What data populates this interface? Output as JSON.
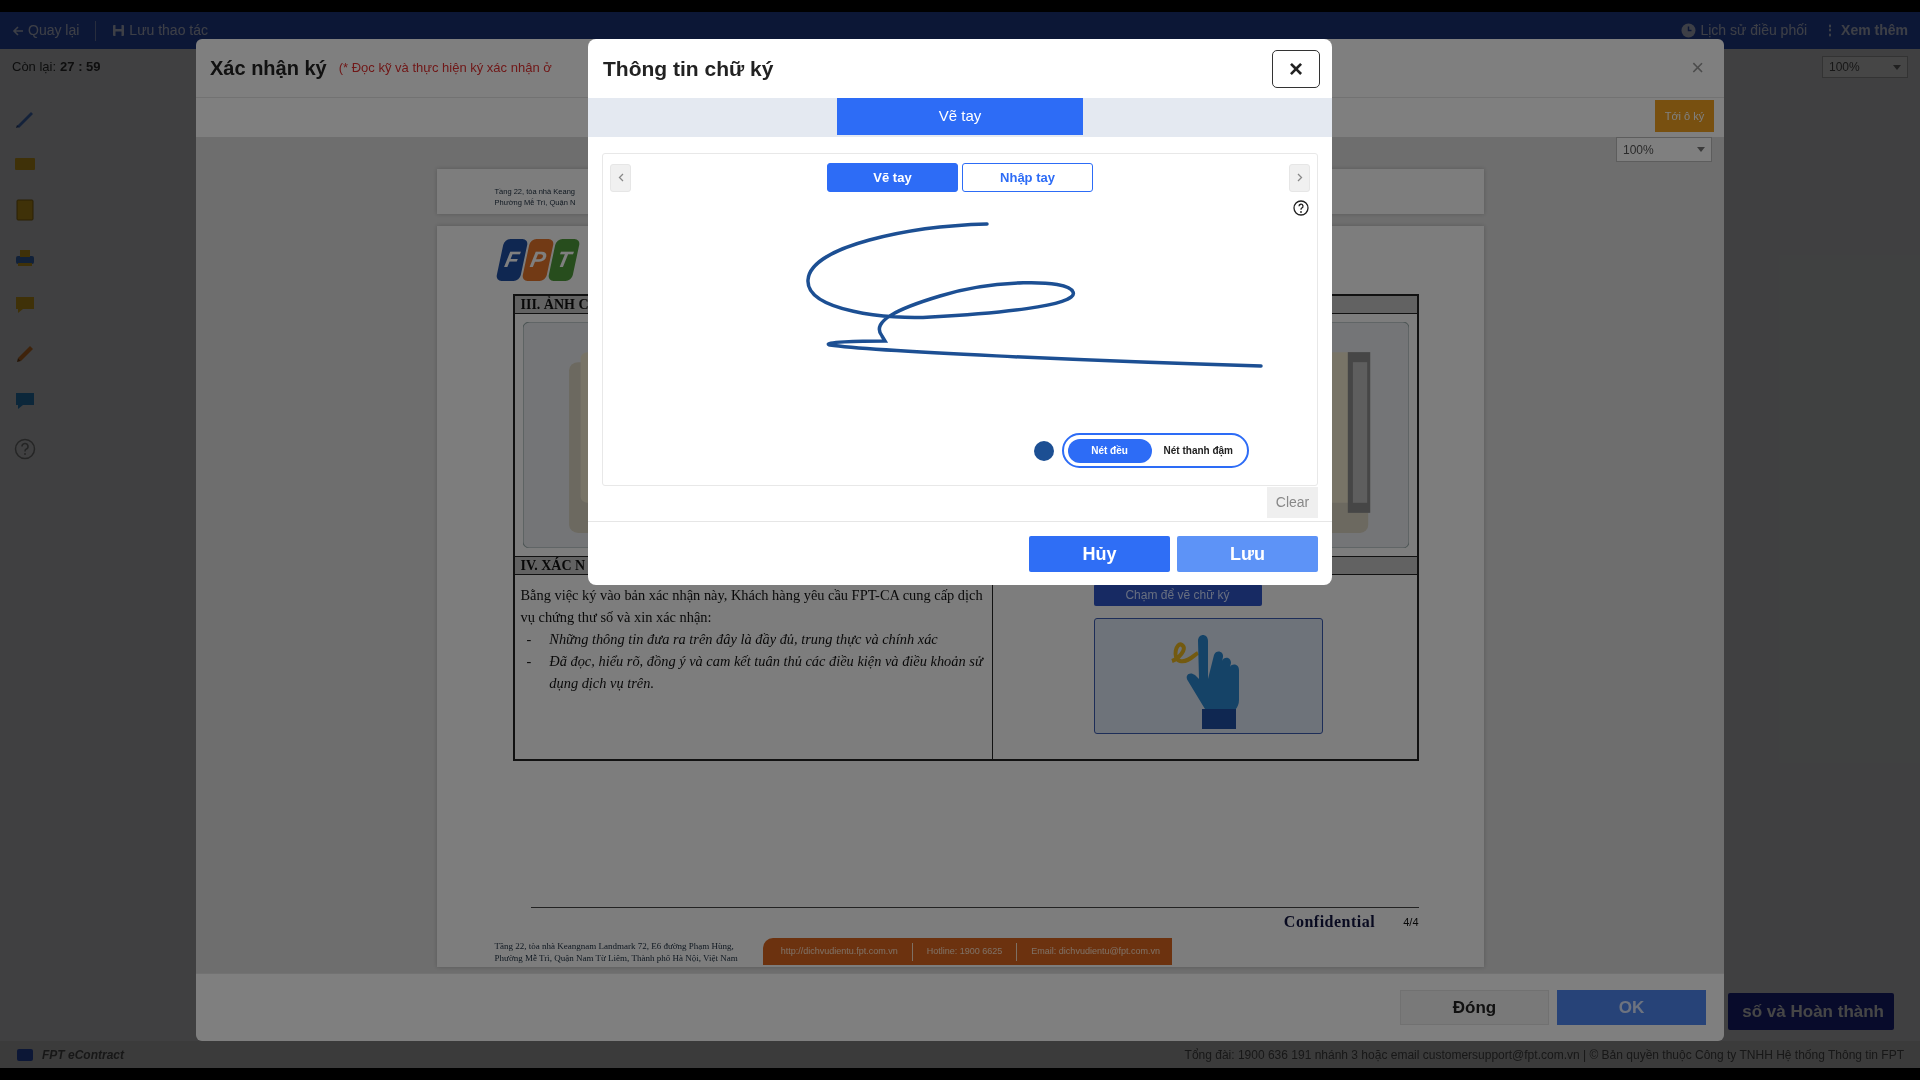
{
  "app": {
    "back": "Quay lại",
    "save": "Lưu thao tác",
    "history": "Lịch sử điều phối",
    "more_icon": "⋮",
    "more": "Xem thêm",
    "timer_label": "Còn lại:",
    "timer": "27 : 59",
    "zoom": "100%",
    "finish_button": "số và Hoàn thành",
    "brand": "FPT eContract",
    "footer_text": "Tổng đài: 1900 636 191 nhánh 3 hoặc email customersupport@fpt.com.vn | © Bản quyền thuộc Công ty TNHH Hệ thống Thông tin FPT"
  },
  "confirm_dialog": {
    "title": "Xác nhận ký",
    "note": "(* Đọc kỹ và thực hiện ký xác nhận ở",
    "close": "×",
    "go_to_sign": "Tới ô ký",
    "zoom": "100%",
    "document": {
      "previous_page_address": [
        "Tầng 22, tòa nhà Keang",
        "Phường Mễ Trì, Quận N"
      ],
      "logo_letters": [
        "F",
        "P",
        "T"
      ],
      "section_3": "III. ẢNH C",
      "section_4": "IV. XÁC N",
      "intro": "Bằng việc ký vào bản xác nhận này, Khách hàng yêu cầu FPT-CA cung cấp dịch vụ chứng thư số và xin xác nhận:",
      "bullets": [
        {
          "mark": "-",
          "text": "Những thông tin đưa ra trên đây là đầy đủ, trung thực và chính xác"
        },
        {
          "mark": "-",
          "text": "Đã đọc, hiểu rõ, đồng ý và cam kết tuân thủ các điều kiện và điều khoản sử dụng dịch vụ trên."
        }
      ],
      "tooltip": "Chạm để vẽ chữ ký",
      "confidential": "Confidential",
      "page": "4/4",
      "address": [
        "Tầng 22, tòa nhà Keangnam Landmark 72, E6 đường Phạm Hùng,",
        "Phường Mễ Trì, Quận Nam Từ Liêm, Thành phố Hà Nội, Việt Nam"
      ],
      "contacts": [
        "http://dichvudientu.fpt.com.vn",
        "Hotline: 1900 6625",
        "Email: dichvudientu@fpt.com.vn"
      ]
    },
    "buttons": [
      {
        "label": "Đóng",
        "kind": "secondary"
      },
      {
        "label": "OK",
        "kind": "primary"
      }
    ]
  },
  "signature_dialog": {
    "title": "Thông tin chữ ký",
    "close": "×",
    "mode_tab": "Vẽ tay",
    "input_modes": [
      {
        "label": "Vẽ tay",
        "selected": true
      },
      {
        "label": "Nhập tay",
        "selected": false
      }
    ],
    "stroke_styles": [
      {
        "label": "Nét đều",
        "selected": true
      },
      {
        "label": "Nét thanh đậm",
        "selected": false
      }
    ],
    "clear": "Clear",
    "buttons": [
      {
        "label": "Hủy",
        "hovered": false
      },
      {
        "label": "Lưu",
        "hovered": true
      }
    ]
  }
}
